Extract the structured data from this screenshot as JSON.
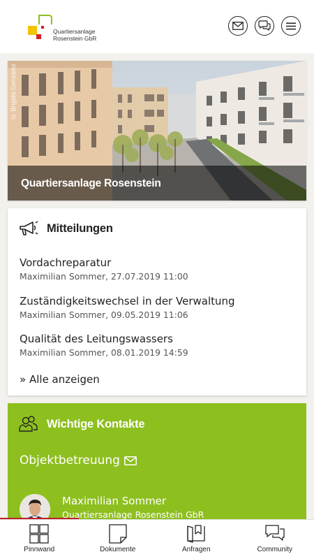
{
  "header": {
    "logo_line1": "Quartiersanlage",
    "logo_line2": "Rosenstein GbR",
    "buttons": [
      "mail-icon",
      "chat-icon",
      "menu-icon"
    ]
  },
  "hero": {
    "title": "Quartiersanlage Rosenstein",
    "credit": "© Brigida González"
  },
  "news": {
    "heading": "Mitteilungen",
    "items": [
      {
        "title": "Vordachreparatur",
        "meta": "Maximilian Sommer, 27.07.2019 11:00"
      },
      {
        "title": "Zuständigkeitswechsel in der Verwaltung",
        "meta": "Maximilian Sommer, 09.05.2019 11:06"
      },
      {
        "title": "Qualität des Leitungswassers",
        "meta": "Maximilian Sommer, 08.01.2019 14:59"
      }
    ],
    "show_all": "Alle anzeigen"
  },
  "contacts": {
    "heading": "Wichtige Kontakte",
    "section": "Objektbetreuung",
    "person_name": "Maximilian Sommer",
    "person_org": "Quartiersanlage Rosenstein GbR",
    "accent": "#8dbf1f"
  },
  "tabs": [
    {
      "label": "Pinnwand",
      "icon": "grid-icon"
    },
    {
      "label": "Dokumente",
      "icon": "document-icon"
    },
    {
      "label": "Anfragen",
      "icon": "inbox-icon"
    },
    {
      "label": "Community",
      "icon": "community-chat-icon"
    }
  ]
}
